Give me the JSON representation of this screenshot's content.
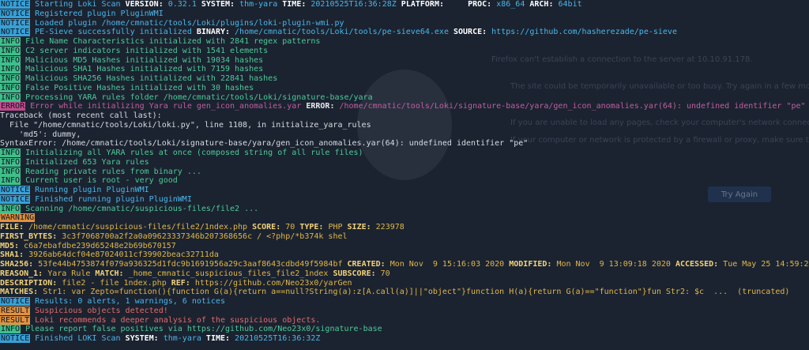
{
  "background": {
    "ghost_texts": [
      "Firefox can't establish a connection to the server at 10.10.91.178.",
      "The site could be temporarily unavailable or too busy. Try again in a few moments.",
      "If you are unable to load any pages, check your computer's network connection.",
      "If your computer or network is protected by a firewall or proxy, make sure that Firefox is permitted to access the Web."
    ],
    "try_again_label": "Try Again"
  },
  "lines": [
    {
      "tag": "NOTICE",
      "cls": "notice",
      "segs": [
        [
          "t",
          "Starting Loki Scan "
        ],
        [
          "k",
          "VERSION:"
        ],
        [
          "t",
          " 0.32.1 "
        ],
        [
          "k",
          "SYSTEM:"
        ],
        [
          "t",
          " thm-yara "
        ],
        [
          "k",
          "TIME:"
        ],
        [
          "t",
          " 20210525T16:36:28Z "
        ],
        [
          "k",
          "PLATFORM:"
        ],
        [
          "t",
          "     "
        ],
        [
          "k",
          "PROC:"
        ],
        [
          "t",
          " x86_64 "
        ],
        [
          "k",
          "ARCH:"
        ],
        [
          "t",
          " 64bit"
        ]
      ]
    },
    {
      "tag": "NOTICE",
      "cls": "notice",
      "segs": [
        [
          "t",
          "Registered plugin PluginWMI"
        ]
      ]
    },
    {
      "tag": "NOTICE",
      "cls": "notice",
      "segs": [
        [
          "t",
          "Loaded plugin /home/cmnatic/tools/Loki/plugins/loki-plugin-wmi.py"
        ]
      ]
    },
    {
      "tag": "NOTICE",
      "cls": "notice",
      "segs": [
        [
          "t",
          "PE-Sieve successfully initialized "
        ],
        [
          "k",
          "BINARY:"
        ],
        [
          "t",
          " /home/cmnatic/tools/Loki/tools/pe-sieve64.exe "
        ],
        [
          "k",
          "SOURCE:"
        ],
        [
          "t",
          " https://github.com/hasherezade/pe-sieve"
        ]
      ]
    },
    {
      "tag": "INFO",
      "cls": "info",
      "segs": [
        [
          "t",
          "File Name Characteristics initialized with 2841 regex patterns"
        ]
      ]
    },
    {
      "tag": "INFO",
      "cls": "info",
      "segs": [
        [
          "t",
          "C2 server indicators initialized with 1541 elements"
        ]
      ]
    },
    {
      "tag": "INFO",
      "cls": "info",
      "segs": [
        [
          "t",
          "Malicious MD5 Hashes initialized with 19034 hashes"
        ]
      ]
    },
    {
      "tag": "INFO",
      "cls": "info",
      "segs": [
        [
          "t",
          "Malicious SHA1 Hashes initialized with 7159 hashes"
        ]
      ]
    },
    {
      "tag": "INFO",
      "cls": "info",
      "segs": [
        [
          "t",
          "Malicious SHA256 Hashes initialized with 22841 hashes"
        ]
      ]
    },
    {
      "tag": "INFO",
      "cls": "info",
      "segs": [
        [
          "t",
          "False Positive Hashes initialized with 30 hashes"
        ]
      ]
    },
    {
      "tag": "INFO",
      "cls": "info",
      "segs": [
        [
          "t",
          "Processing YARA rules folder /home/cmnatic/tools/Loki/signature-base/yara"
        ]
      ]
    },
    {
      "tag": "ERROR",
      "cls": "error",
      "segs": [
        [
          "t",
          "Error while initializing Yara rule gen_icon_anomalies.yar "
        ],
        [
          "ke",
          "ERROR:"
        ],
        [
          "t",
          " /home/cmnatic/tools/Loki/signature-base/yara/gen_icon_anomalies.yar(64): undefined identifier \"pe\""
        ]
      ]
    },
    {
      "tag": "",
      "cls": "plain",
      "segs": [
        [
          "t",
          "Traceback (most recent call last):"
        ]
      ]
    },
    {
      "tag": "",
      "cls": "plain",
      "segs": [
        [
          "t",
          "  File \"/home/cmnatic/tools/Loki/loki.py\", line 1108, in initialize_yara_rules"
        ]
      ]
    },
    {
      "tag": "",
      "cls": "plain",
      "segs": [
        [
          "t",
          "    'md5': dummy,"
        ]
      ]
    },
    {
      "tag": "",
      "cls": "plain",
      "segs": [
        [
          "t",
          "SyntaxError: /home/cmnatic/tools/Loki/signature-base/yara/gen_icon_anomalies.yar(64): undefined identifier \"pe\""
        ]
      ]
    },
    {
      "tag": "INFO",
      "cls": "info",
      "segs": [
        [
          "t",
          "Initializing all YARA rules at once (composed string of all rule files)"
        ]
      ]
    },
    {
      "tag": "INFO",
      "cls": "info",
      "segs": [
        [
          "t",
          "Initialized 653 Yara rules"
        ]
      ]
    },
    {
      "tag": "INFO",
      "cls": "info",
      "segs": [
        [
          "t",
          "Reading private rules from binary ..."
        ]
      ]
    },
    {
      "tag": "INFO",
      "cls": "info",
      "segs": [
        [
          "t",
          "Current user is root - very good"
        ]
      ]
    },
    {
      "tag": "NOTICE",
      "cls": "notice",
      "segs": [
        [
          "t",
          "Running plugin PluginWMI"
        ]
      ]
    },
    {
      "tag": "NOTICE",
      "cls": "notice",
      "segs": [
        [
          "t",
          "Finished running plugin PluginWMI"
        ]
      ]
    },
    {
      "tag": "INFO",
      "cls": "info",
      "segs": [
        [
          "t",
          "Scanning /home/cmnatic/suspicious-files/file2 ..."
        ]
      ]
    },
    {
      "tag": "WARNING",
      "cls": "warning",
      "segs": []
    },
    {
      "tag": "",
      "cls": "warn",
      "segs": [
        [
          "kw",
          "FILE:"
        ],
        [
          "t",
          " /home/cmnatic/suspicious-files/file2/1ndex.php "
        ],
        [
          "kw",
          "SCORE:"
        ],
        [
          "t",
          " 70 "
        ],
        [
          "kw",
          "TYPE:"
        ],
        [
          "t",
          " PHP "
        ],
        [
          "kw",
          "SIZE:"
        ],
        [
          "t",
          " 223978"
        ]
      ]
    },
    {
      "tag": "",
      "cls": "warn",
      "segs": [
        [
          "kw",
          "FIRST_BYTES:"
        ],
        [
          "t",
          " 3c3f7068700a2f2a0a09623337346b207368656c / <?php/*b374k shel"
        ]
      ]
    },
    {
      "tag": "",
      "cls": "warn",
      "segs": [
        [
          "kw",
          "MD5:"
        ],
        [
          "t",
          " c6a7ebafdbe239d65248e2b69b670157"
        ]
      ]
    },
    {
      "tag": "",
      "cls": "warn",
      "segs": [
        [
          "kw",
          "SHA1:"
        ],
        [
          "t",
          " 3926ab64dcf04e87024011cf39902beac32711da"
        ]
      ]
    },
    {
      "tag": "",
      "cls": "warn",
      "segs": [
        [
          "kw",
          "SHA256:"
        ],
        [
          "t",
          " 53fe44b4753874f079a936325d1fdc9b1691956a29c3aaf8643cdbd49f5984bf "
        ],
        [
          "kw",
          "CREATED:"
        ],
        [
          "t",
          " Mon Nov  9 15:16:03 2020 "
        ],
        [
          "kw",
          "MODIFIED:"
        ],
        [
          "t",
          " Mon Nov  9 13:09:18 2020 "
        ],
        [
          "kw",
          "ACCESSED:"
        ],
        [
          "t",
          " Tue May 25 14:59:22 2021"
        ]
      ]
    },
    {
      "tag": "",
      "cls": "warn",
      "segs": [
        [
          "kw",
          "REASON_1:"
        ],
        [
          "t",
          " Yara Rule "
        ],
        [
          "kw",
          "MATCH:"
        ],
        [
          "t",
          " _home_cmnatic_suspicious_files_file2_1ndex "
        ],
        [
          "kw",
          "SUBSCORE:"
        ],
        [
          "t",
          " 70"
        ]
      ]
    },
    {
      "tag": "",
      "cls": "warn",
      "segs": [
        [
          "kw",
          "DESCRIPTION:"
        ],
        [
          "t",
          " file2 - file 1ndex.php "
        ],
        [
          "kw",
          "REF:"
        ],
        [
          "t",
          " https://github.com/Neo23x0/yarGen"
        ]
      ]
    },
    {
      "tag": "",
      "cls": "warn",
      "segs": [
        [
          "kw",
          "MATCHES:"
        ],
        [
          "t",
          " Str1: var Zepto=function(){function G(a){return a==null?String(a):z[A.call(a)]||\"object\"}function H(a){return G(a)==\"function\"}fun Str2: $c  ...  (truncated)"
        ]
      ]
    },
    {
      "tag": "NOTICE",
      "cls": "notice",
      "segs": [
        [
          "t",
          "Results: 0 alerts, 1 warnings, 6 notices"
        ]
      ]
    },
    {
      "tag": "RESULT",
      "cls": "result",
      "segs": [
        [
          "t",
          "Suspicious objects detected!"
        ]
      ]
    },
    {
      "tag": "RESULT",
      "cls": "result",
      "segs": [
        [
          "t",
          "Loki recommends a deeper analysis of the suspicious objects."
        ]
      ]
    },
    {
      "tag": "INFO",
      "cls": "info",
      "segs": [
        [
          "t",
          "Please report false positives via https://github.com/Neo23x0/signature-base"
        ]
      ]
    },
    {
      "tag": "NOTICE",
      "cls": "notice",
      "segs": [
        [
          "t",
          "Finished LOKI Scan "
        ],
        [
          "k",
          "SYSTEM:"
        ],
        [
          "t",
          " thm-yara "
        ],
        [
          "k",
          "TIME:"
        ],
        [
          "t",
          " 20210525T16:36:32Z"
        ]
      ]
    }
  ]
}
